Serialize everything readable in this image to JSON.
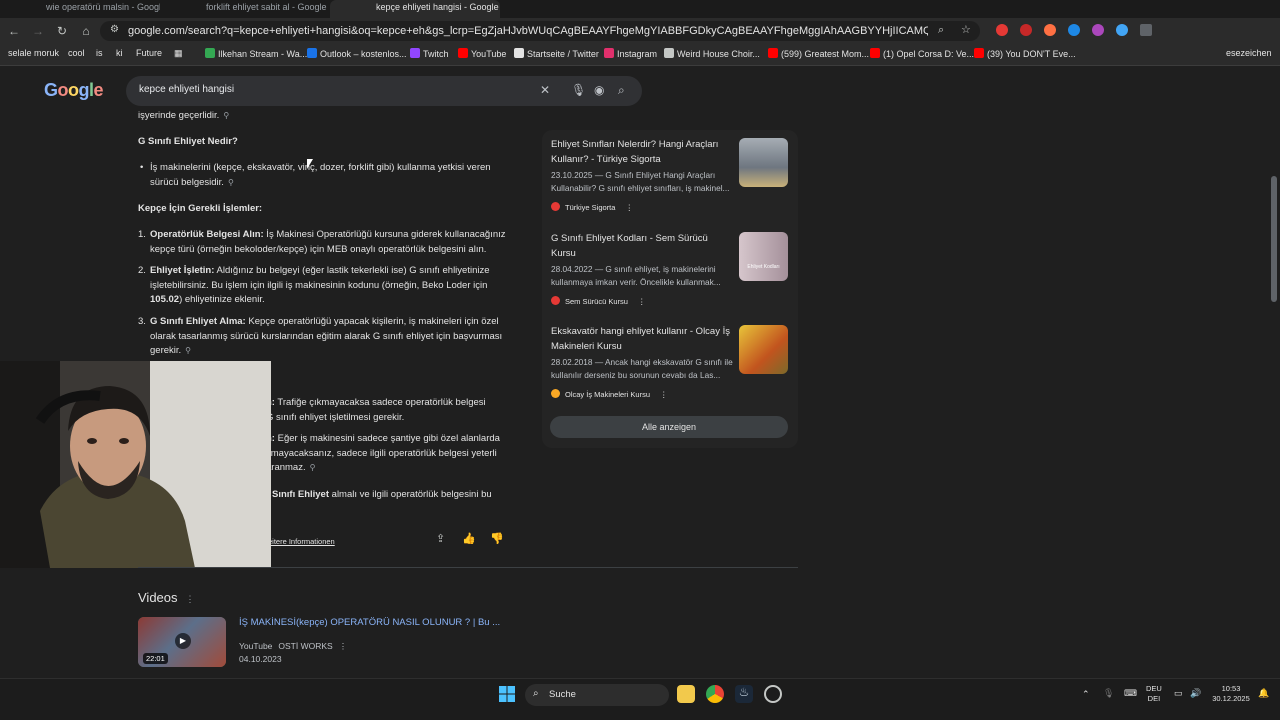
{
  "tabs": [
    {
      "label": "wie operatörü malsin - Google"
    },
    {
      "label": "forklift ehliyet sabit al - Google"
    },
    {
      "label": "kepçe ehliyeti hangisi - Google"
    }
  ],
  "toolbar": {
    "url": "google.com/search?q=kepce+ehliyeti+hangisi&oq=kepce+eh&gs_lcrp=EgZjaHJvbWUqCAgBEAAYFhgeMgYIABBFGDkyCAgBEAAYFhgeMggIAhAAGBYYHjIICAMQABgWGB4yCAgEEAAYFhgeMggI..."
  },
  "bookmarks": [
    {
      "label": "selale moruk",
      "color": "#2b2b2b"
    },
    {
      "label": "cool",
      "color": "#2b2b2b"
    },
    {
      "label": "is",
      "color": "#2b2b2b"
    },
    {
      "label": "ki",
      "color": "#2b2b2b"
    },
    {
      "label": "Future",
      "color": "#2b2b2b"
    },
    {
      "label": "Ilkehan Stream - Wa...",
      "color": "#34a853"
    },
    {
      "label": "Outlook – kostenlos...",
      "color": "#1a73e8"
    },
    {
      "label": "Twitch",
      "color": "#9146ff"
    },
    {
      "label": "YouTube",
      "color": "#ff0000"
    },
    {
      "label": "Startseite / Twitter",
      "color": "#e3e3e3"
    },
    {
      "label": "Instagram",
      "color": "#e1306c"
    },
    {
      "label": "Weird House Choir...",
      "color": "#c4c7c5"
    },
    {
      "label": "(599) Greatest Mom...",
      "color": "#ff0000"
    },
    {
      "label": "(1) Opel Corsa D: Ve...",
      "color": "#ff0000"
    },
    {
      "label": "(39) You DON'T Eve...",
      "color": "#ff0000"
    }
  ],
  "bookmarks_more": "esezeichen",
  "search": {
    "logo": "Google",
    "query": "kepce ehliyeti hangisi"
  },
  "ai": {
    "cutoff": "işyerinde geçerlidir.",
    "h1": "G Sınıfı Ehliyet Nedir?",
    "bullet1": "İş makinelerini (kepçe, ekskavatör, vinç, dozer, forklift gibi) kullanma yetkisi veren",
    "bullet1b": "sürücü belgesidir.",
    "h2": "Kepçe İçin Gerekli İşlemler:",
    "s1_num": "1.",
    "s1_bold": "Operatörlük Belgesi Alın:",
    "s1_rest": " İş Makinesi Operatörlüğü kursuna giderek kullanacağınız",
    "s1_l2": "kepçe türü (örneğin bekoloder/kepçe) için MEB onaylı operatörlük belgesini alın.",
    "s2_num": "2.",
    "s2_bold": "Ehliyet İşletin:",
    "s2_rest": " Aldığınız bu belgeyi (eğer lastik tekerlekli ise) G sınıfı ehliyetinize",
    "s2_l2": "işletebilirsiniz. Bu işlem için ilgili iş makinesinin kodunu (örneğin, Beko Loder için",
    "s2_l3_bold": "105.02",
    "s2_l3_rest": ") ehliyetinize eklenir.",
    "s3_num": "3.",
    "s3_bold": "G Sınıfı Ehliyet Alma:",
    "s3_rest": " Kepçe operatörlüğü yapacak kişilerin, iş makineleri için özel",
    "s3_l2": "olarak tasarlanmış sürücü kurslarından eğitim alarak G sınıfı ehliyet için başvurması",
    "s3_l3": "gerekir.",
    "p1_bold": "n:",
    "p1_rest": " Trafiğe çıkmayacaksa sadece operatörlük belgesi",
    "p1_l2": "G sınıfı ehliyet işletilmesi gerekir.",
    "p2_bold": "n:",
    "p2_rest": " Eğer iş makinesini sadece şantiye gibi özel alanlarda",
    "p2_l2": "kmayacaksanız, sadece ilgili operatörlük belgesi yeterli",
    "p2_l3": "aranmaz.",
    "p3_bold": "Sınıfı Ehliyet",
    "p3_rest": " almalı ve ilgili operatörlük belgesini bu",
    "more_info": "eitere Informationen"
  },
  "sources": [
    {
      "title": "Ehliyet Sınıfları Nelerdir? Hangi Araçları Kullanır? - Türkiye Sigorta",
      "snippet": "23.10.2025 — G Sınıfı Ehliyet Hangi Araçları Kullanabilir? G sınıfı ehliyet sınıfları, iş makinel...",
      "source": "Türkiye Sigorta",
      "color": "#e53935",
      "thumb": "#8a9199"
    },
    {
      "title": "G Sınıfı Ehliyet Kodları - Sem Sürücü Kursu",
      "snippet": "28.04.2022 — G sınıfı ehliyet, iş makinelerini kullanmaya imkan verir. Öncelikle kullanmak...",
      "source": "Sem Sürücü Kursu",
      "color": "#e53935",
      "thumb": "#b8a7b0",
      "thumb_text": "Ehliyet Kodları"
    },
    {
      "title": "Ekskavatör hangi ehliyet kullanır - Olcay İş Makineleri Kursu",
      "snippet": "28.02.2018 — Ancak hangi ekskavatör G sınıfı ile kullanılır derseniz bu sorunun cevabı da Las...",
      "source": "Olcay İş Makineleri Kursu",
      "color": "#f9a825",
      "thumb": "#c9a235"
    }
  ],
  "show_all": "Alle anzeigen",
  "videos": {
    "heading": "Videos",
    "title": "İŞ MAKİNESİ(kepçe) OPERATÖRÜ NASIL OLUNUR ? | Bu ...",
    "platform": "YouTube",
    "channel": "OSTİ WORKS",
    "date": "04.10.2023",
    "duration": "22:01"
  },
  "taskbar": {
    "search": "Suche",
    "lang1": "DEU",
    "lang2": "DEI",
    "time": "10:53",
    "date": "30.12.2025"
  }
}
